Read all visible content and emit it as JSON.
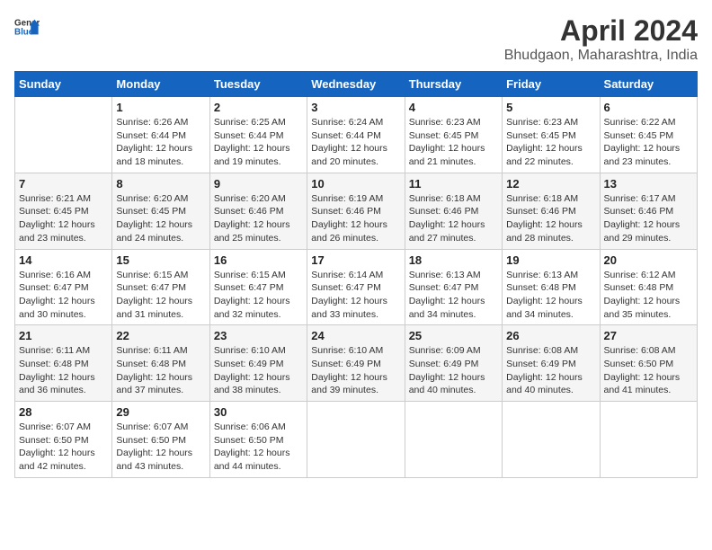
{
  "header": {
    "logo_general": "General",
    "logo_blue": "Blue",
    "month": "April 2024",
    "location": "Bhudgaon, Maharashtra, India"
  },
  "weekdays": [
    "Sunday",
    "Monday",
    "Tuesday",
    "Wednesday",
    "Thursday",
    "Friday",
    "Saturday"
  ],
  "weeks": [
    [
      {
        "day": "",
        "sunrise": "",
        "sunset": "",
        "daylight": ""
      },
      {
        "day": "1",
        "sunrise": "Sunrise: 6:26 AM",
        "sunset": "Sunset: 6:44 PM",
        "daylight": "Daylight: 12 hours and 18 minutes."
      },
      {
        "day": "2",
        "sunrise": "Sunrise: 6:25 AM",
        "sunset": "Sunset: 6:44 PM",
        "daylight": "Daylight: 12 hours and 19 minutes."
      },
      {
        "day": "3",
        "sunrise": "Sunrise: 6:24 AM",
        "sunset": "Sunset: 6:44 PM",
        "daylight": "Daylight: 12 hours and 20 minutes."
      },
      {
        "day": "4",
        "sunrise": "Sunrise: 6:23 AM",
        "sunset": "Sunset: 6:45 PM",
        "daylight": "Daylight: 12 hours and 21 minutes."
      },
      {
        "day": "5",
        "sunrise": "Sunrise: 6:23 AM",
        "sunset": "Sunset: 6:45 PM",
        "daylight": "Daylight: 12 hours and 22 minutes."
      },
      {
        "day": "6",
        "sunrise": "Sunrise: 6:22 AM",
        "sunset": "Sunset: 6:45 PM",
        "daylight": "Daylight: 12 hours and 23 minutes."
      }
    ],
    [
      {
        "day": "7",
        "sunrise": "Sunrise: 6:21 AM",
        "sunset": "Sunset: 6:45 PM",
        "daylight": "Daylight: 12 hours and 23 minutes."
      },
      {
        "day": "8",
        "sunrise": "Sunrise: 6:20 AM",
        "sunset": "Sunset: 6:45 PM",
        "daylight": "Daylight: 12 hours and 24 minutes."
      },
      {
        "day": "9",
        "sunrise": "Sunrise: 6:20 AM",
        "sunset": "Sunset: 6:46 PM",
        "daylight": "Daylight: 12 hours and 25 minutes."
      },
      {
        "day": "10",
        "sunrise": "Sunrise: 6:19 AM",
        "sunset": "Sunset: 6:46 PM",
        "daylight": "Daylight: 12 hours and 26 minutes."
      },
      {
        "day": "11",
        "sunrise": "Sunrise: 6:18 AM",
        "sunset": "Sunset: 6:46 PM",
        "daylight": "Daylight: 12 hours and 27 minutes."
      },
      {
        "day": "12",
        "sunrise": "Sunrise: 6:18 AM",
        "sunset": "Sunset: 6:46 PM",
        "daylight": "Daylight: 12 hours and 28 minutes."
      },
      {
        "day": "13",
        "sunrise": "Sunrise: 6:17 AM",
        "sunset": "Sunset: 6:46 PM",
        "daylight": "Daylight: 12 hours and 29 minutes."
      }
    ],
    [
      {
        "day": "14",
        "sunrise": "Sunrise: 6:16 AM",
        "sunset": "Sunset: 6:47 PM",
        "daylight": "Daylight: 12 hours and 30 minutes."
      },
      {
        "day": "15",
        "sunrise": "Sunrise: 6:15 AM",
        "sunset": "Sunset: 6:47 PM",
        "daylight": "Daylight: 12 hours and 31 minutes."
      },
      {
        "day": "16",
        "sunrise": "Sunrise: 6:15 AM",
        "sunset": "Sunset: 6:47 PM",
        "daylight": "Daylight: 12 hours and 32 minutes."
      },
      {
        "day": "17",
        "sunrise": "Sunrise: 6:14 AM",
        "sunset": "Sunset: 6:47 PM",
        "daylight": "Daylight: 12 hours and 33 minutes."
      },
      {
        "day": "18",
        "sunrise": "Sunrise: 6:13 AM",
        "sunset": "Sunset: 6:47 PM",
        "daylight": "Daylight: 12 hours and 34 minutes."
      },
      {
        "day": "19",
        "sunrise": "Sunrise: 6:13 AM",
        "sunset": "Sunset: 6:48 PM",
        "daylight": "Daylight: 12 hours and 34 minutes."
      },
      {
        "day": "20",
        "sunrise": "Sunrise: 6:12 AM",
        "sunset": "Sunset: 6:48 PM",
        "daylight": "Daylight: 12 hours and 35 minutes."
      }
    ],
    [
      {
        "day": "21",
        "sunrise": "Sunrise: 6:11 AM",
        "sunset": "Sunset: 6:48 PM",
        "daylight": "Daylight: 12 hours and 36 minutes."
      },
      {
        "day": "22",
        "sunrise": "Sunrise: 6:11 AM",
        "sunset": "Sunset: 6:48 PM",
        "daylight": "Daylight: 12 hours and 37 minutes."
      },
      {
        "day": "23",
        "sunrise": "Sunrise: 6:10 AM",
        "sunset": "Sunset: 6:49 PM",
        "daylight": "Daylight: 12 hours and 38 minutes."
      },
      {
        "day": "24",
        "sunrise": "Sunrise: 6:10 AM",
        "sunset": "Sunset: 6:49 PM",
        "daylight": "Daylight: 12 hours and 39 minutes."
      },
      {
        "day": "25",
        "sunrise": "Sunrise: 6:09 AM",
        "sunset": "Sunset: 6:49 PM",
        "daylight": "Daylight: 12 hours and 40 minutes."
      },
      {
        "day": "26",
        "sunrise": "Sunrise: 6:08 AM",
        "sunset": "Sunset: 6:49 PM",
        "daylight": "Daylight: 12 hours and 40 minutes."
      },
      {
        "day": "27",
        "sunrise": "Sunrise: 6:08 AM",
        "sunset": "Sunset: 6:50 PM",
        "daylight": "Daylight: 12 hours and 41 minutes."
      }
    ],
    [
      {
        "day": "28",
        "sunrise": "Sunrise: 6:07 AM",
        "sunset": "Sunset: 6:50 PM",
        "daylight": "Daylight: 12 hours and 42 minutes."
      },
      {
        "day": "29",
        "sunrise": "Sunrise: 6:07 AM",
        "sunset": "Sunset: 6:50 PM",
        "daylight": "Daylight: 12 hours and 43 minutes."
      },
      {
        "day": "30",
        "sunrise": "Sunrise: 6:06 AM",
        "sunset": "Sunset: 6:50 PM",
        "daylight": "Daylight: 12 hours and 44 minutes."
      },
      {
        "day": "",
        "sunrise": "",
        "sunset": "",
        "daylight": ""
      },
      {
        "day": "",
        "sunrise": "",
        "sunset": "",
        "daylight": ""
      },
      {
        "day": "",
        "sunrise": "",
        "sunset": "",
        "daylight": ""
      },
      {
        "day": "",
        "sunrise": "",
        "sunset": "",
        "daylight": ""
      }
    ]
  ]
}
